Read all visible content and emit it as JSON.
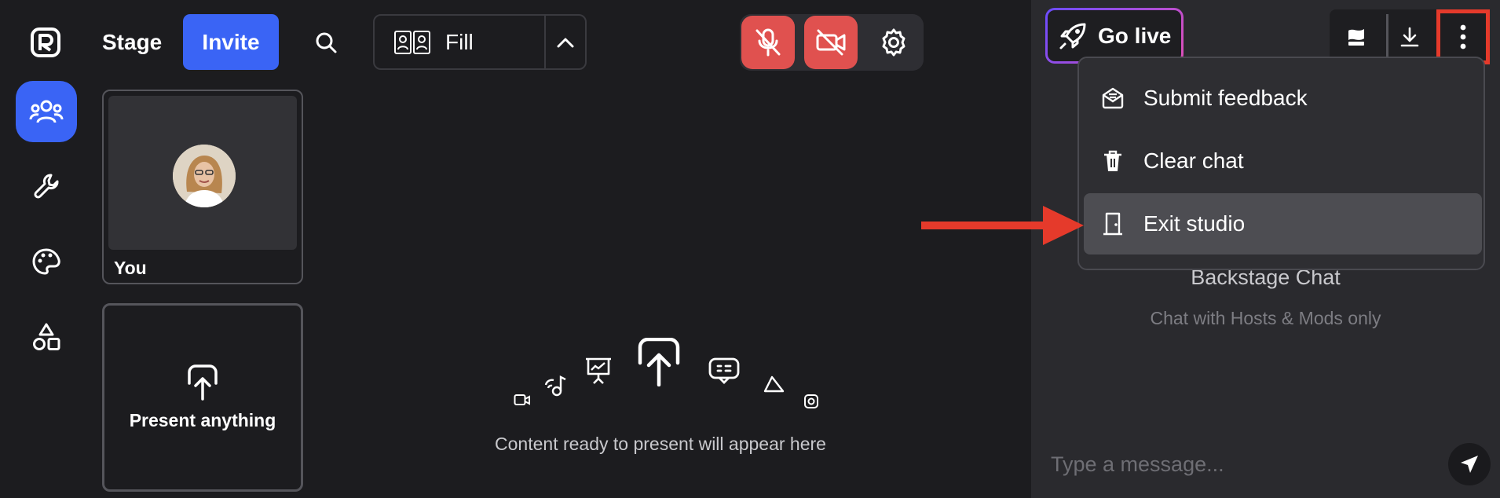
{
  "header": {
    "stage_label": "Stage",
    "invite_label": "Invite",
    "layout_label": "Fill"
  },
  "rail": {
    "items": [
      "people-icon",
      "wrench-icon",
      "palette-icon",
      "shapes-icon"
    ]
  },
  "tiles": {
    "you_label": "You",
    "present_label": "Present anything"
  },
  "center": {
    "empty_text": "Content ready to present will appear here"
  },
  "right": {
    "go_live_label": "Go live",
    "backstage_title": "Backstage Chat",
    "backstage_sub": "Chat with Hosts & Mods only",
    "input_placeholder": "Type a message..."
  },
  "menu": {
    "items": [
      {
        "label": "Submit feedback",
        "icon": "feedback-icon"
      },
      {
        "label": "Clear chat",
        "icon": "trash-icon"
      },
      {
        "label": "Exit studio",
        "icon": "door-icon"
      }
    ]
  },
  "colors": {
    "accent": "#3a64f5",
    "danger": "#e0514f",
    "annotation": "#e53a2b"
  }
}
